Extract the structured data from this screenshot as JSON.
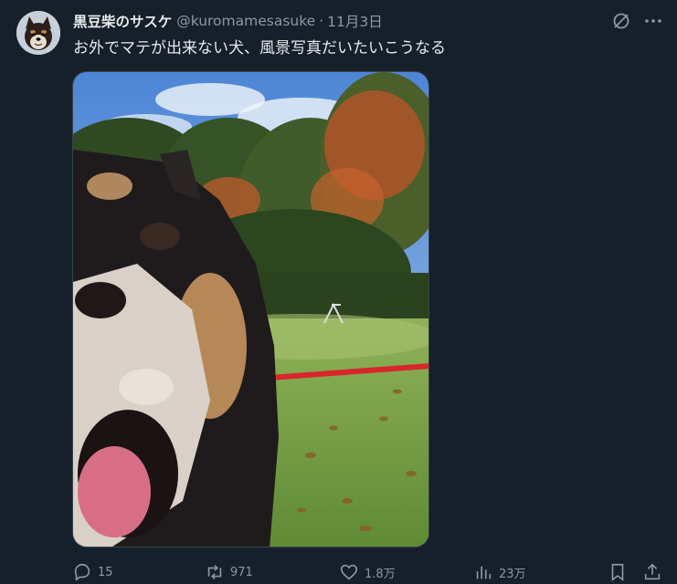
{
  "tweet": {
    "author_name": "黒豆柴のサスケ",
    "handle": "@kuromamesasuke",
    "separator": "·",
    "date": "11月3日",
    "text": "お外でマテが出来ない犬、風景写真だいたいこうなる"
  },
  "actions": {
    "reply_count": "15",
    "retweet_count": "971",
    "like_count": "1.8万",
    "view_count": "23万"
  },
  "icons": {
    "top_right": [
      "grok-icon",
      "more-icon"
    ],
    "bottom": [
      "reply-icon",
      "retweet-icon",
      "like-icon",
      "views-icon",
      "bookmark-icon",
      "share-icon"
    ]
  },
  "colors": {
    "background": "#15202b",
    "text_primary": "#e7e9ea",
    "text_secondary": "#8b98a5"
  }
}
